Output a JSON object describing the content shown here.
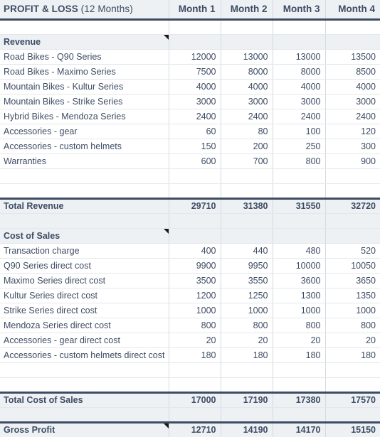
{
  "sheet": {
    "title_main": "PROFIT & LOSS",
    "title_sub": " (12 Months)",
    "columns": [
      "Month 1",
      "Month 2",
      "Month 3",
      "Month 4"
    ],
    "accent_dark": "#3e4c63",
    "tint_bg": "#edf1f4",
    "grid_line": "#d4dae1"
  },
  "rows": [
    {
      "kind": "blank",
      "label": "",
      "values": [
        "",
        "",
        "",
        ""
      ]
    },
    {
      "kind": "section",
      "label": "Revenue",
      "values": [
        "",
        "",
        "",
        ""
      ],
      "marker": true
    },
    {
      "kind": "item",
      "label": "Road Bikes - Q90 Series",
      "values": [
        "12000",
        "13000",
        "13000",
        "13500"
      ]
    },
    {
      "kind": "item",
      "label": "Road Bikes - Maximo Series",
      "values": [
        "7500",
        "8000",
        "8000",
        "8500"
      ]
    },
    {
      "kind": "item",
      "label": "Mountain Bikes - Kultur Series",
      "values": [
        "4000",
        "4000",
        "4000",
        "4000"
      ]
    },
    {
      "kind": "item",
      "label": "Mountain Bikes  - Strike Series",
      "values": [
        "3000",
        "3000",
        "3000",
        "3000"
      ]
    },
    {
      "kind": "item",
      "label": "Hybrid Bikes - Mendoza Series",
      "values": [
        "2400",
        "2400",
        "2400",
        "2400"
      ]
    },
    {
      "kind": "item",
      "label": "Accessories - gear",
      "values": [
        "60",
        "80",
        "100",
        "120"
      ]
    },
    {
      "kind": "item",
      "label": "Accessories - custom helmets",
      "values": [
        "150",
        "200",
        "250",
        "300"
      ]
    },
    {
      "kind": "item",
      "label": "Warranties",
      "values": [
        "600",
        "700",
        "800",
        "900"
      ]
    },
    {
      "kind": "blank",
      "label": "",
      "values": [
        "",
        "",
        "",
        ""
      ]
    },
    {
      "kind": "blank",
      "label": "",
      "values": [
        "",
        "",
        "",
        ""
      ]
    },
    {
      "kind": "total",
      "label": "Total Revenue",
      "values": [
        "29710",
        "31380",
        "31550",
        "32720"
      ]
    },
    {
      "kind": "tintspace",
      "label": "",
      "values": [
        "",
        "",
        "",
        ""
      ]
    },
    {
      "kind": "section",
      "label": "Cost of Sales",
      "values": [
        "",
        "",
        "",
        ""
      ],
      "marker": true
    },
    {
      "kind": "item",
      "label": "Transaction charge",
      "values": [
        "400",
        "440",
        "480",
        "520"
      ]
    },
    {
      "kind": "item",
      "label": "Q90 Series direct cost",
      "values": [
        "9900",
        "9950",
        "10000",
        "10050"
      ]
    },
    {
      "kind": "item",
      "label": "Maximo Series direct cost",
      "values": [
        "3500",
        "3550",
        "3600",
        "3650"
      ]
    },
    {
      "kind": "item",
      "label": "Kultur Series direct cost",
      "values": [
        "1200",
        "1250",
        "1300",
        "1350"
      ]
    },
    {
      "kind": "item",
      "label": "Strike Series direct cost",
      "values": [
        "1000",
        "1000",
        "1000",
        "1000"
      ]
    },
    {
      "kind": "item",
      "label": "Mendoza Series direct cost",
      "values": [
        "800",
        "800",
        "800",
        "800"
      ]
    },
    {
      "kind": "item",
      "label": "Accessories - gear direct cost",
      "values": [
        "20",
        "20",
        "20",
        "20"
      ]
    },
    {
      "kind": "item",
      "label": "Accessories - custom helmets direct cost",
      "values": [
        "180",
        "180",
        "180",
        "180"
      ]
    },
    {
      "kind": "blank",
      "label": "",
      "values": [
        "",
        "",
        "",
        ""
      ]
    },
    {
      "kind": "blank",
      "label": "",
      "values": [
        "",
        "",
        "",
        ""
      ]
    },
    {
      "kind": "total",
      "label": "Total Cost of Sales",
      "values": [
        "17000",
        "17190",
        "17380",
        "17570"
      ]
    },
    {
      "kind": "tintspace",
      "label": "",
      "values": [
        "",
        "",
        "",
        ""
      ]
    },
    {
      "kind": "total",
      "label": "Gross Profit",
      "values": [
        "12710",
        "14190",
        "14170",
        "15150"
      ],
      "marker": true
    }
  ]
}
